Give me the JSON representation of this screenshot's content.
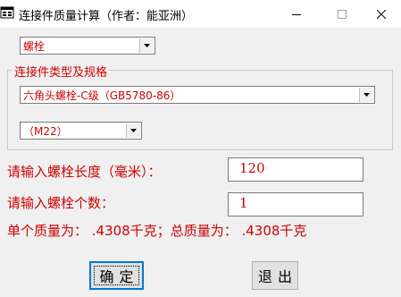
{
  "window": {
    "title": "连接件质量计算（作者：能亚洲）",
    "minimize_label": "—",
    "maximize_label": "□",
    "close_label": "✕"
  },
  "form": {
    "type_select": {
      "value": "螺栓"
    },
    "group_title": "连接件类型及规格",
    "spec_select": {
      "value": "六角头螺栓-C级（GB5780-86）"
    },
    "size_select": {
      "value": "（M22）"
    },
    "length_label": "请输入螺栓长度（毫米）：",
    "length_value": "120",
    "count_label": "请输入螺栓个数：",
    "count_value": "1",
    "result_text": "单个质量为：  .4308千克；总质量为：  .4308千克"
  },
  "buttons": {
    "ok_label": "确定",
    "exit_label": "退出"
  },
  "colors": {
    "accent_text": "#d00000",
    "focus_border": "#0078d7"
  }
}
